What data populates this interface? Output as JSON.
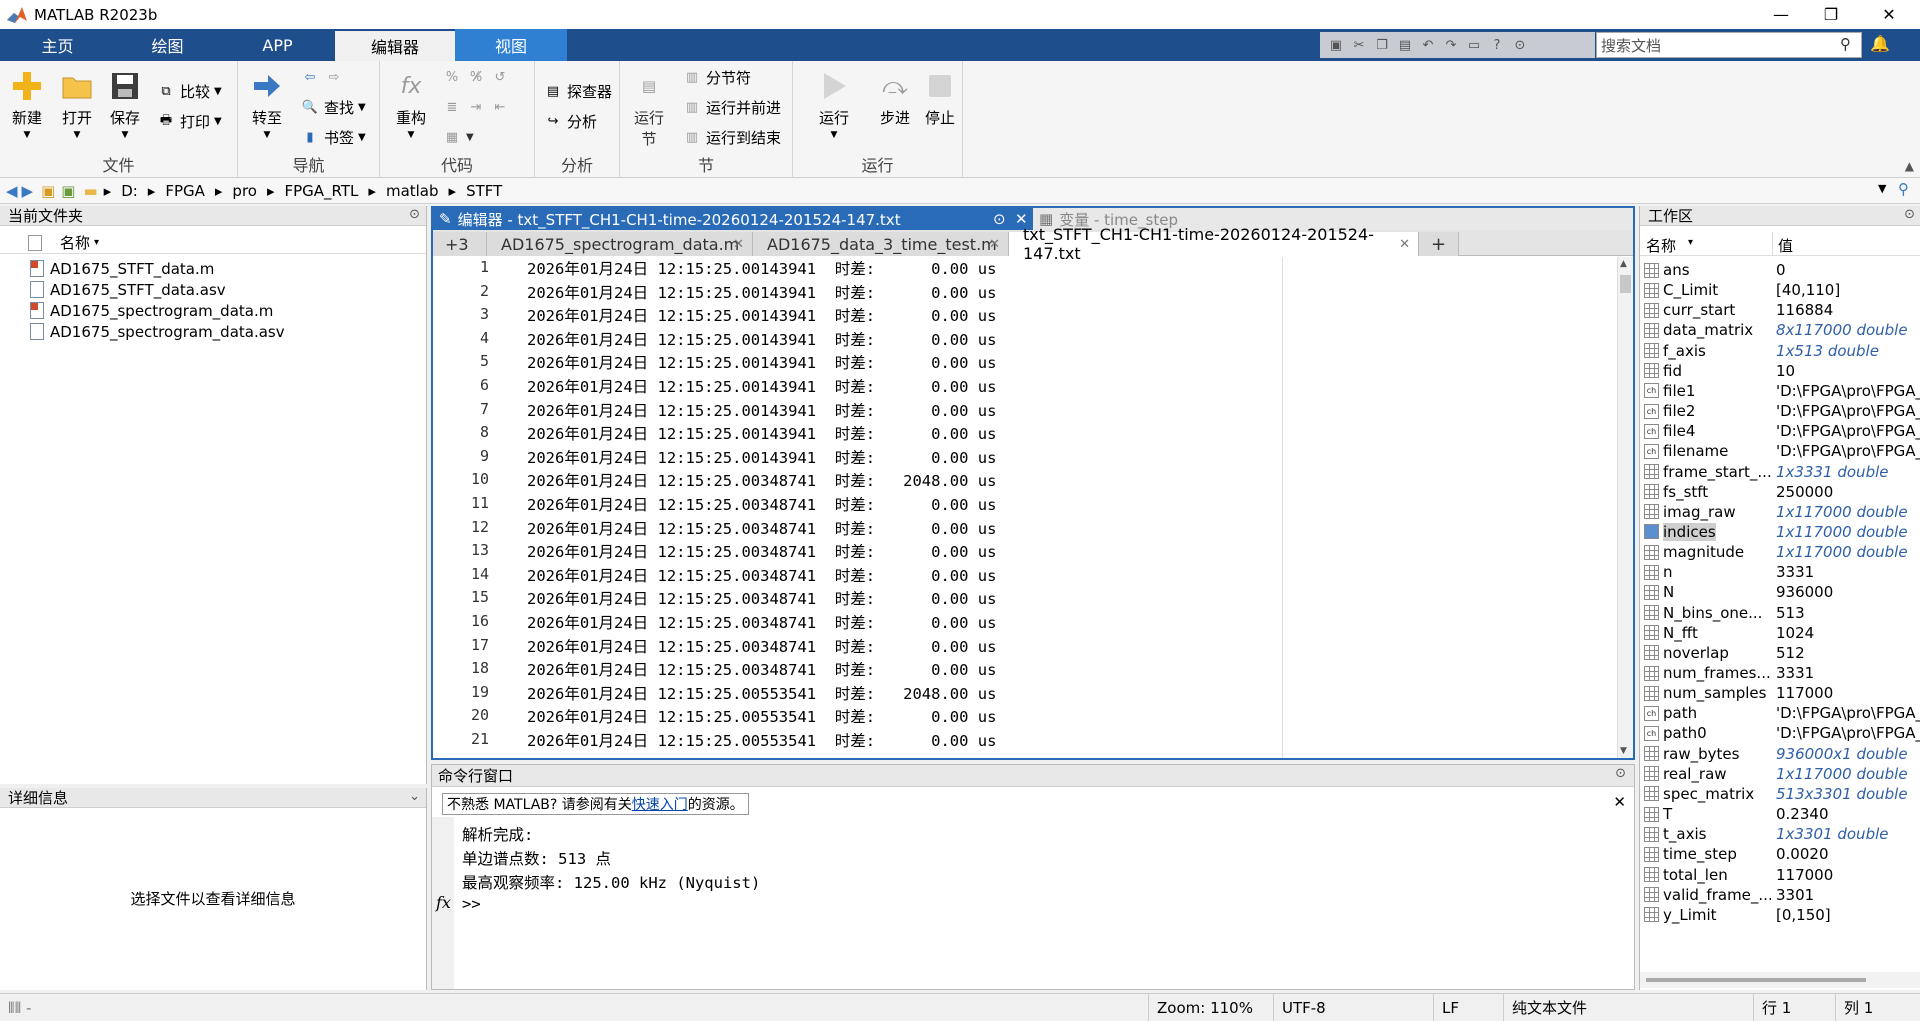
{
  "app": {
    "title": "MATLAB R2023b"
  },
  "ribbon_tabs": [
    "主页",
    "绘图",
    "APP",
    "编辑器",
    "视图"
  ],
  "search": {
    "placeholder": "搜索文档"
  },
  "ribbon": {
    "file": {
      "label": "文件",
      "new": "新建",
      "open": "打开",
      "save": "保存",
      "compare": "比较",
      "print": "打印"
    },
    "nav": {
      "label": "导航",
      "goto": "转至",
      "find": "查找",
      "bookmark": "书签"
    },
    "code": {
      "label": "代码",
      "refactor": "重构"
    },
    "analyze": {
      "label": "分析",
      "explorer": "探查器",
      "analyze": "分析"
    },
    "section": {
      "label": "节",
      "run_section": "运行\n节",
      "section_break": "分节符",
      "run_advance": "运行并前进",
      "run_to_end": "运行到结束"
    },
    "run": {
      "label": "运行",
      "run": "运行",
      "step": "步进",
      "stop": "停止"
    }
  },
  "address": [
    "D:",
    "FPGA",
    "pro",
    "FPGA_RTL",
    "matlab",
    "STFT"
  ],
  "current_folder": {
    "title": "当前文件夹",
    "col_name": "名称",
    "files": [
      {
        "name": "AD1675_STFT_data.m",
        "type": "m"
      },
      {
        "name": "AD1675_STFT_data.asv",
        "type": "asv"
      },
      {
        "name": "AD1675_spectrogram_data.m",
        "type": "m"
      },
      {
        "name": "AD1675_spectrogram_data.asv",
        "type": "asv"
      }
    ]
  },
  "details": {
    "title": "详细信息",
    "empty": "选择文件以查看详细信息"
  },
  "editor": {
    "title": "编辑器 - txt_STFT_CH1-CH1-time-20260124-201524-147.txt",
    "var_title": "变量 - time_step",
    "overflow": "+3",
    "tabs": [
      "AD1675_spectrogram_data.m",
      "AD1675_data_3_time_test.m",
      "txt_STFT_CH1-CH1-time-20260124-201524-147.txt"
    ],
    "lines": [
      "2026年01月24日 12:15:25.00143941  时差:      0.00 us",
      "2026年01月24日 12:15:25.00143941  时差:      0.00 us",
      "2026年01月24日 12:15:25.00143941  时差:      0.00 us",
      "2026年01月24日 12:15:25.00143941  时差:      0.00 us",
      "2026年01月24日 12:15:25.00143941  时差:      0.00 us",
      "2026年01月24日 12:15:25.00143941  时差:      0.00 us",
      "2026年01月24日 12:15:25.00143941  时差:      0.00 us",
      "2026年01月24日 12:15:25.00143941  时差:      0.00 us",
      "2026年01月24日 12:15:25.00143941  时差:      0.00 us",
      "2026年01月24日 12:15:25.00348741  时差:   2048.00 us",
      "2026年01月24日 12:15:25.00348741  时差:      0.00 us",
      "2026年01月24日 12:15:25.00348741  时差:      0.00 us",
      "2026年01月24日 12:15:25.00348741  时差:      0.00 us",
      "2026年01月24日 12:15:25.00348741  时差:      0.00 us",
      "2026年01月24日 12:15:25.00348741  时差:      0.00 us",
      "2026年01月24日 12:15:25.00348741  时差:      0.00 us",
      "2026年01月24日 12:15:25.00348741  时差:      0.00 us",
      "2026年01月24日 12:15:25.00348741  时差:      0.00 us",
      "2026年01月24日 12:15:25.00553541  时差:   2048.00 us",
      "2026年01月24日 12:15:25.00553541  时差:      0.00 us",
      "2026年01月24日 12:15:25.00553541  时差:      0.00 us"
    ]
  },
  "command": {
    "title": "命令行窗口",
    "notice_pre": "不熟悉 MATLAB? 请参阅有关",
    "notice_link": "快速入门",
    "notice_post": "的资源。",
    "lines": [
      "解析完成:",
      "单边谱点数: 513 点",
      "最高观察频率: 125.00 kHz (Nyquist)"
    ],
    "prompt": ">>"
  },
  "workspace": {
    "title": "工作区",
    "col_name": "名称",
    "col_value": "值",
    "vars": [
      {
        "name": "ans",
        "value": "0",
        "italic": false,
        "icon": "matrix"
      },
      {
        "name": "C_Limit",
        "value": "[40,110]",
        "italic": false,
        "icon": "matrix"
      },
      {
        "name": "curr_start",
        "value": "116884",
        "italic": false,
        "icon": "matrix"
      },
      {
        "name": "data_matrix",
        "value": "8x117000 double",
        "italic": true,
        "icon": "matrix"
      },
      {
        "name": "f_axis",
        "value": "1x513 double",
        "italic": true,
        "icon": "matrix"
      },
      {
        "name": "fid",
        "value": "10",
        "italic": false,
        "icon": "matrix"
      },
      {
        "name": "file1",
        "value": "'D:\\FPGA\\pro\\FPGA_",
        "italic": false,
        "icon": "char"
      },
      {
        "name": "file2",
        "value": "'D:\\FPGA\\pro\\FPGA_",
        "italic": false,
        "icon": "char"
      },
      {
        "name": "file4",
        "value": "'D:\\FPGA\\pro\\FPGA_",
        "italic": false,
        "icon": "char"
      },
      {
        "name": "filename",
        "value": "'D:\\FPGA\\pro\\FPGA_",
        "italic": false,
        "icon": "char"
      },
      {
        "name": "frame_start_...",
        "value": "1x3331 double",
        "italic": true,
        "icon": "matrix"
      },
      {
        "name": "fs_stft",
        "value": "250000",
        "italic": false,
        "icon": "matrix"
      },
      {
        "name": "imag_raw",
        "value": "1x117000 double",
        "italic": true,
        "icon": "matrix"
      },
      {
        "name": "indices",
        "value": "1x117000 double",
        "italic": true,
        "icon": "matrix",
        "selected": true
      },
      {
        "name": "magnitude",
        "value": "1x117000 double",
        "italic": true,
        "icon": "matrix"
      },
      {
        "name": "n",
        "value": "3331",
        "italic": false,
        "icon": "matrix"
      },
      {
        "name": "N",
        "value": "936000",
        "italic": false,
        "icon": "matrix"
      },
      {
        "name": "N_bins_one...",
        "value": "513",
        "italic": false,
        "icon": "matrix"
      },
      {
        "name": "N_fft",
        "value": "1024",
        "italic": false,
        "icon": "matrix"
      },
      {
        "name": "noverlap",
        "value": "512",
        "italic": false,
        "icon": "matrix"
      },
      {
        "name": "num_frames...",
        "value": "3331",
        "italic": false,
        "icon": "matrix"
      },
      {
        "name": "num_samples",
        "value": "117000",
        "italic": false,
        "icon": "matrix"
      },
      {
        "name": "path",
        "value": "'D:\\FPGA\\pro\\FPGA_",
        "italic": false,
        "icon": "char"
      },
      {
        "name": "path0",
        "value": "'D:\\FPGA\\pro\\FPGA_",
        "italic": false,
        "icon": "char"
      },
      {
        "name": "raw_bytes",
        "value": "936000x1 double",
        "italic": true,
        "icon": "matrix"
      },
      {
        "name": "real_raw",
        "value": "1x117000 double",
        "italic": true,
        "icon": "matrix"
      },
      {
        "name": "spec_matrix",
        "value": "513x3301 double",
        "italic": true,
        "icon": "matrix"
      },
      {
        "name": "T",
        "value": "0.2340",
        "italic": false,
        "icon": "matrix"
      },
      {
        "name": "t_axis",
        "value": "1x3301 double",
        "italic": true,
        "icon": "matrix"
      },
      {
        "name": "time_step",
        "value": "0.0020",
        "italic": false,
        "icon": "matrix"
      },
      {
        "name": "total_len",
        "value": "117000",
        "italic": false,
        "icon": "matrix"
      },
      {
        "name": "valid_frame_...",
        "value": "3301",
        "italic": false,
        "icon": "matrix"
      },
      {
        "name": "y_Limit",
        "value": "[0,150]",
        "italic": false,
        "icon": "matrix"
      }
    ]
  },
  "status": {
    "zoom": "Zoom: 110%",
    "encoding": "UTF-8",
    "eol": "LF",
    "filetype": "纯文本文件",
    "row": "行  1",
    "col": "列  1"
  },
  "colors": {
    "tabbar": "#1f4e8c",
    "view_tab": "#2f80d3",
    "editor_accent": "#2a6bb8"
  }
}
